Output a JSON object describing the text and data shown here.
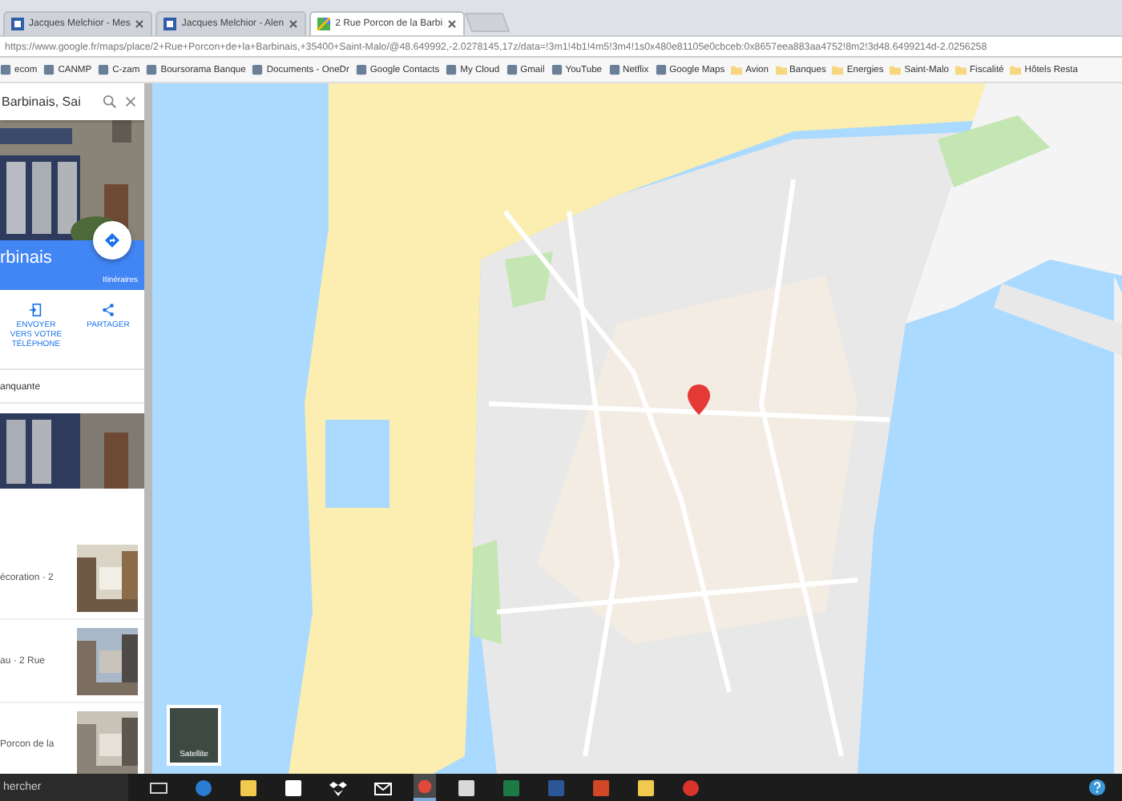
{
  "tabs": [
    {
      "title": "Jacques Melchior - Mes",
      "kind": "page",
      "selected": false
    },
    {
      "title": "Jacques Melchior - Alen",
      "kind": "page",
      "selected": false
    },
    {
      "title": "2 Rue Porcon de la Barbi",
      "kind": "maps",
      "selected": true
    }
  ],
  "address_bar": {
    "url": "https://www.google.fr/maps/place/2+Rue+Porcon+de+la+Barbinais,+35400+Saint-Malo/@48.649992,-2.0278145,17z/data=!3m1!4b1!4m5!3m4!1s0x480e81105e0cbceb:0x8657eea883aa4752!8m2!3d48.6499214d-2.0256258"
  },
  "bookmarks": [
    {
      "label": "ecom",
      "kind": "site"
    },
    {
      "label": "CANMP",
      "kind": "site"
    },
    {
      "label": "C-zam",
      "kind": "site"
    },
    {
      "label": "Boursorama Banque",
      "kind": "site"
    },
    {
      "label": "Documents - OneDr",
      "kind": "site"
    },
    {
      "label": "Google Contacts",
      "kind": "site"
    },
    {
      "label": "My Cloud",
      "kind": "site"
    },
    {
      "label": "Gmail",
      "kind": "site"
    },
    {
      "label": "YouTube",
      "kind": "site"
    },
    {
      "label": "Netflix",
      "kind": "site"
    },
    {
      "label": "Google Maps",
      "kind": "site"
    },
    {
      "label": "Avion",
      "kind": "folder"
    },
    {
      "label": "Banques",
      "kind": "folder"
    },
    {
      "label": "Energies",
      "kind": "folder"
    },
    {
      "label": "Saint-Malo",
      "kind": "folder"
    },
    {
      "label": "Fiscalité",
      "kind": "folder"
    },
    {
      "label": "Hôtels Resta",
      "kind": "folder"
    }
  ],
  "side_panel": {
    "search": {
      "value": "Barbinais, Sai"
    },
    "place_title": "rbinais",
    "directions_label": "Itinéraires",
    "actions": [
      {
        "label": "ENVOYER VERS VOTRE TÉLÉPHONE",
        "kind": "send"
      },
      {
        "label": "PARTAGER",
        "kind": "share"
      }
    ],
    "info_line": "anquante",
    "results": [
      {
        "text": "écoration · 2"
      },
      {
        "text": "au · 2 Rue"
      },
      {
        "text": "Porcon de la"
      }
    ]
  },
  "map": {
    "kind": "picture",
    "layer_button": "Satellite"
  },
  "taskbar": {
    "search_placeholder": "hercher",
    "apps": [
      {
        "kind": "taskview",
        "active": false
      },
      {
        "kind": "edge",
        "active": false
      },
      {
        "kind": "explorer",
        "active": false
      },
      {
        "kind": "store",
        "active": false
      },
      {
        "kind": "dropbox",
        "active": false
      },
      {
        "kind": "mail",
        "active": false
      },
      {
        "kind": "chrome",
        "active": true
      },
      {
        "kind": "calculator",
        "active": false
      },
      {
        "kind": "excel",
        "active": false
      },
      {
        "kind": "word",
        "active": false
      },
      {
        "kind": "powerpoint",
        "active": false
      },
      {
        "kind": "drive",
        "active": false
      },
      {
        "kind": "ccleaner",
        "active": false
      }
    ]
  }
}
